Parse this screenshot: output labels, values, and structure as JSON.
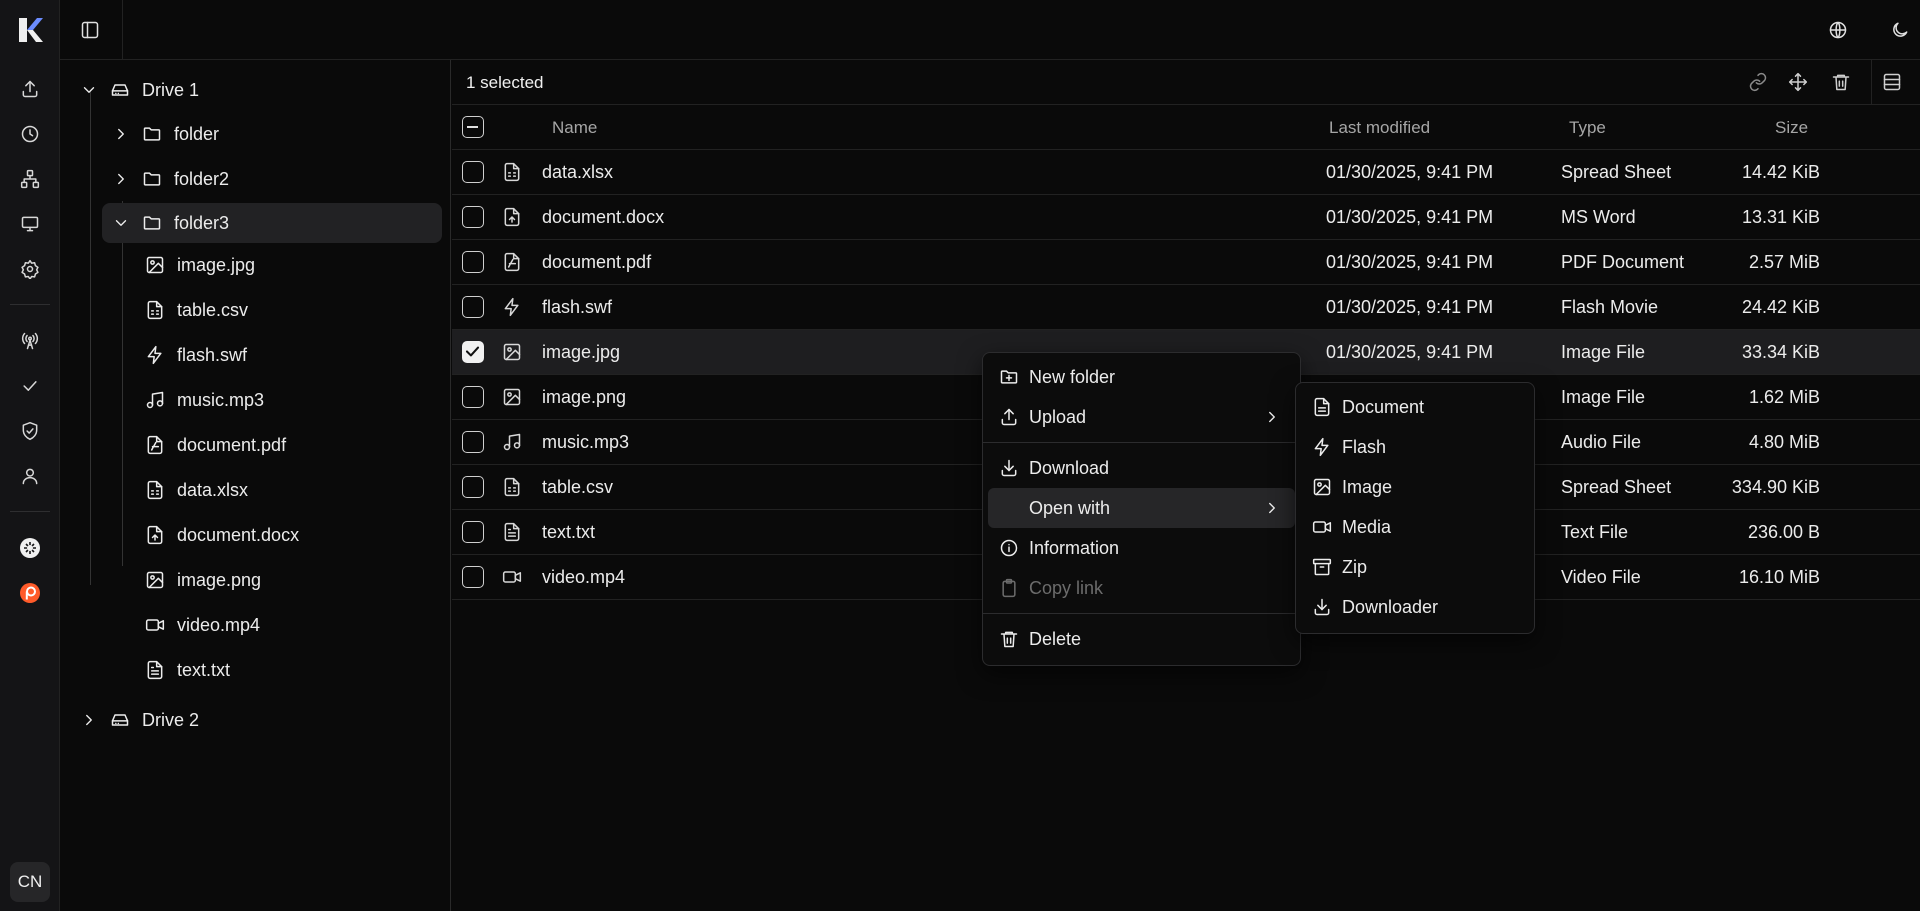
{
  "user": {
    "initials": "CN"
  },
  "tree": {
    "drive1": "Drive 1",
    "folder": "folder",
    "folder2": "folder2",
    "folder3": "folder3",
    "children": [
      "image.jpg",
      "table.csv",
      "flash.swf",
      "music.mp3",
      "document.pdf",
      "data.xlsx",
      "document.docx",
      "image.png",
      "video.mp4",
      "text.txt"
    ],
    "drive2": "Drive 2"
  },
  "toolbar": {
    "selected_label": "1 selected"
  },
  "table": {
    "headers": {
      "name": "Name",
      "modified": "Last modified",
      "type": "Type",
      "size": "Size"
    },
    "rows": [
      {
        "name": "data.xlsx",
        "modified": "01/30/2025, 9:41 PM",
        "type": "Spread Sheet",
        "size": "14.42 KiB",
        "icon": "spreadsheet-icon",
        "checked": false
      },
      {
        "name": "document.docx",
        "modified": "01/30/2025, 9:41 PM",
        "type": "MS Word",
        "size": "13.31 KiB",
        "icon": "word-document-icon",
        "checked": false
      },
      {
        "name": "document.pdf",
        "modified": "01/30/2025, 9:41 PM",
        "type": "PDF Document",
        "size": "2.57 MiB",
        "icon": "pdf-icon",
        "checked": false
      },
      {
        "name": "flash.swf",
        "modified": "01/30/2025, 9:41 PM",
        "type": "Flash Movie",
        "size": "24.42 KiB",
        "icon": "flash-icon",
        "checked": false
      },
      {
        "name": "image.jpg",
        "modified": "01/30/2025, 9:41 PM",
        "type": "Image File",
        "size": "33.34 KiB",
        "icon": "image-icon",
        "checked": true
      },
      {
        "name": "image.png",
        "modified": "",
        "type": "Image File",
        "size": "1.62 MiB",
        "icon": "image-icon",
        "checked": false
      },
      {
        "name": "music.mp3",
        "modified": "",
        "type": "Audio File",
        "size": "4.80 MiB",
        "icon": "music-icon",
        "checked": false
      },
      {
        "name": "table.csv",
        "modified": "",
        "type": "Spread Sheet",
        "size": "334.90 KiB",
        "icon": "spreadsheet-icon",
        "checked": false
      },
      {
        "name": "text.txt",
        "modified": "",
        "type": "Text File",
        "size": "236.00 B",
        "icon": "text-file-icon",
        "checked": false
      },
      {
        "name": "video.mp4",
        "modified": "",
        "type": "Video File",
        "size": "16.10 MiB",
        "icon": "video-icon",
        "checked": false
      }
    ]
  },
  "context_menu": {
    "items": [
      "New folder",
      "Upload",
      "Download",
      "Open with",
      "Information",
      "Copy link",
      "Delete"
    ],
    "active": "Open with",
    "disabled": "Copy link"
  },
  "submenu": {
    "items": [
      "Document",
      "Flash",
      "Image",
      "Media",
      "Zip",
      "Downloader"
    ]
  }
}
